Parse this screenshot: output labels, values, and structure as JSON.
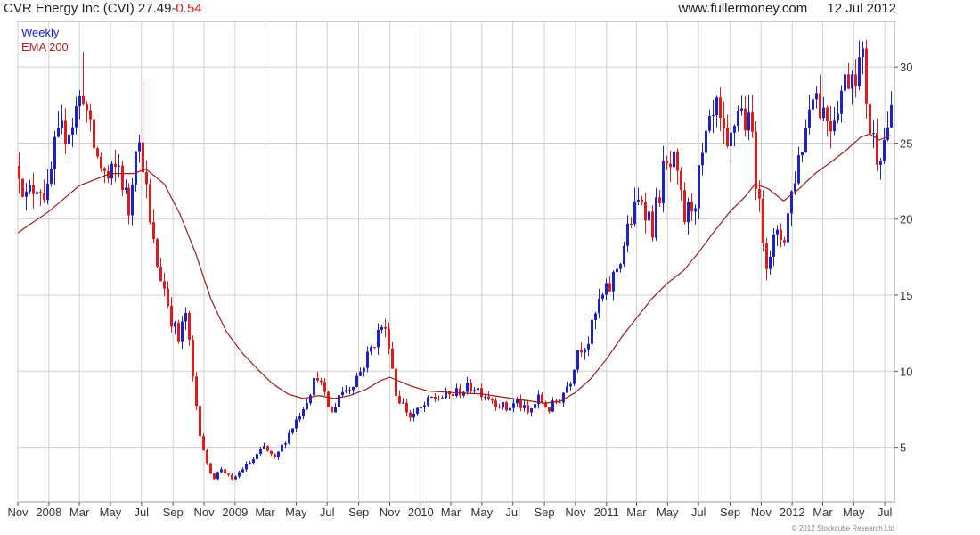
{
  "header": {
    "company": "CVR Energy Inc (CVI)",
    "price": "27.49",
    "change": "-0.54",
    "site": "www.fullermoney.com",
    "date": "12 Jul 2012"
  },
  "footer": {
    "credit": "© 2012 Stockcube Research Ltd"
  },
  "colors": {
    "up": "#1a22c8",
    "down": "#e01b1b",
    "ema": "#9b1c1c",
    "grid": "#cfcfcf",
    "axis": "#555555"
  },
  "chart_data": {
    "type": "candlestick",
    "frequency_label": "Weekly",
    "indicator_label": "EMA 200",
    "x_range": [
      "2007-11-01",
      "2012-07-20"
    ],
    "y_range": [
      1.4,
      33
    ],
    "y_ticks": [
      5,
      10,
      15,
      20,
      25,
      30
    ],
    "x_ticks": [
      {
        "date": "2007-11-01",
        "label": "Nov"
      },
      {
        "date": "2008-01-01",
        "label": "2008"
      },
      {
        "date": "2008-03-01",
        "label": "Mar"
      },
      {
        "date": "2008-05-01",
        "label": "May"
      },
      {
        "date": "2008-07-01",
        "label": "Jul"
      },
      {
        "date": "2008-09-01",
        "label": "Sep"
      },
      {
        "date": "2008-11-01",
        "label": "Nov"
      },
      {
        "date": "2009-01-01",
        "label": "2009"
      },
      {
        "date": "2009-03-01",
        "label": "Mar"
      },
      {
        "date": "2009-05-01",
        "label": "May"
      },
      {
        "date": "2009-07-01",
        "label": "Jul"
      },
      {
        "date": "2009-09-01",
        "label": "Sep"
      },
      {
        "date": "2009-11-01",
        "label": "Nov"
      },
      {
        "date": "2010-01-01",
        "label": "2010"
      },
      {
        "date": "2010-03-01",
        "label": "Mar"
      },
      {
        "date": "2010-05-01",
        "label": "May"
      },
      {
        "date": "2010-07-01",
        "label": "Jul"
      },
      {
        "date": "2010-09-01",
        "label": "Sep"
      },
      {
        "date": "2010-11-01",
        "label": "Nov"
      },
      {
        "date": "2011-01-01",
        "label": "2011"
      },
      {
        "date": "2011-03-01",
        "label": "Mar"
      },
      {
        "date": "2011-05-01",
        "label": "May"
      },
      {
        "date": "2011-07-01",
        "label": "Jul"
      },
      {
        "date": "2011-09-01",
        "label": "Sep"
      },
      {
        "date": "2011-11-01",
        "label": "Nov"
      },
      {
        "date": "2012-01-01",
        "label": "2012"
      },
      {
        "date": "2012-03-01",
        "label": "Mar"
      },
      {
        "date": "2012-05-01",
        "label": "May"
      },
      {
        "date": "2012-07-01",
        "label": "Jul"
      }
    ],
    "close_path": [
      [
        "2007-11-02",
        23.5
      ],
      [
        "2007-11-16",
        21.3
      ],
      [
        "2007-12-07",
        22.5
      ],
      [
        "2007-12-28",
        21.5
      ],
      [
        "2008-01-11",
        24.5
      ],
      [
        "2008-01-25",
        25.5
      ],
      [
        "2008-02-15",
        26.5
      ],
      [
        "2008-03-07",
        28.5
      ],
      [
        "2008-03-21",
        25.5
      ],
      [
        "2008-04-04",
        24.0
      ],
      [
        "2008-04-25",
        22.5
      ],
      [
        "2008-05-16",
        23.5
      ],
      [
        "2008-06-06",
        20.5
      ],
      [
        "2008-06-20",
        25.5
      ],
      [
        "2008-07-04",
        24.0
      ],
      [
        "2008-07-18",
        19.5
      ],
      [
        "2008-08-01",
        17.0
      ],
      [
        "2008-08-15",
        15.5
      ],
      [
        "2008-08-29",
        13.5
      ],
      [
        "2008-09-12",
        12.0
      ],
      [
        "2008-09-26",
        13.8
      ],
      [
        "2008-10-10",
        9.5
      ],
      [
        "2008-10-24",
        6.0
      ],
      [
        "2008-11-07",
        3.8
      ],
      [
        "2008-11-21",
        3.0
      ],
      [
        "2008-12-05",
        3.6
      ],
      [
        "2008-12-26",
        2.8
      ],
      [
        "2009-01-16",
        3.6
      ],
      [
        "2009-02-06",
        4.2
      ],
      [
        "2009-02-27",
        5.0
      ],
      [
        "2009-03-20",
        4.2
      ],
      [
        "2009-04-10",
        5.5
      ],
      [
        "2009-05-01",
        6.8
      ],
      [
        "2009-05-22",
        8.2
      ],
      [
        "2009-06-12",
        9.8
      ],
      [
        "2009-06-26",
        8.3
      ],
      [
        "2009-07-10",
        7.2
      ],
      [
        "2009-07-24",
        8.5
      ],
      [
        "2009-08-14",
        9.0
      ],
      [
        "2009-09-04",
        10.0
      ],
      [
        "2009-09-25",
        11.5
      ],
      [
        "2009-10-16",
        13.0
      ],
      [
        "2009-10-30",
        12.0
      ],
      [
        "2009-11-13",
        8.5
      ],
      [
        "2009-11-27",
        7.8
      ],
      [
        "2009-12-11",
        7.0
      ],
      [
        "2010-01-01",
        7.5
      ],
      [
        "2010-01-22",
        8.2
      ],
      [
        "2010-02-12",
        8.3
      ],
      [
        "2010-03-05",
        8.5
      ],
      [
        "2010-03-26",
        8.8
      ],
      [
        "2010-04-16",
        9.0
      ],
      [
        "2010-05-07",
        8.5
      ],
      [
        "2010-05-28",
        8.0
      ],
      [
        "2010-06-18",
        7.5
      ],
      [
        "2010-07-09",
        8.0
      ],
      [
        "2010-07-30",
        7.2
      ],
      [
        "2010-08-20",
        8.2
      ],
      [
        "2010-09-10",
        7.5
      ],
      [
        "2010-10-01",
        8.2
      ],
      [
        "2010-10-22",
        9.5
      ],
      [
        "2010-11-05",
        11.5
      ],
      [
        "2010-11-26",
        12.0
      ],
      [
        "2010-12-17",
        14.5
      ],
      [
        "2011-01-07",
        15.5
      ],
      [
        "2011-01-28",
        17.5
      ],
      [
        "2011-02-18",
        20.0
      ],
      [
        "2011-03-11",
        21.5
      ],
      [
        "2011-04-01",
        19.5
      ],
      [
        "2011-04-22",
        23.0
      ],
      [
        "2011-05-13",
        23.5
      ],
      [
        "2011-06-03",
        20.0
      ],
      [
        "2011-06-24",
        21.5
      ],
      [
        "2011-07-15",
        25.0
      ],
      [
        "2011-08-05",
        27.0
      ],
      [
        "2011-08-26",
        24.0
      ],
      [
        "2011-09-16",
        27.5
      ],
      [
        "2011-09-30",
        26.5
      ],
      [
        "2011-10-14",
        25.5
      ],
      [
        "2011-10-28",
        20.5
      ],
      [
        "2011-11-11",
        17.5
      ],
      [
        "2011-11-25",
        18.5
      ],
      [
        "2011-12-16",
        19.0
      ],
      [
        "2012-01-06",
        23.0
      ],
      [
        "2012-01-27",
        26.0
      ],
      [
        "2012-02-10",
        29.0
      ],
      [
        "2012-02-24",
        27.5
      ],
      [
        "2012-03-16",
        26.5
      ],
      [
        "2012-04-06",
        28.5
      ],
      [
        "2012-04-27",
        30.0
      ],
      [
        "2012-05-18",
        30.2
      ],
      [
        "2012-06-01",
        26.0
      ],
      [
        "2012-06-15",
        24.5
      ],
      [
        "2012-06-29",
        25.2
      ],
      [
        "2012-07-13",
        27.5
      ]
    ],
    "ema_path": [
      [
        "2007-11-01",
        19.1
      ],
      [
        "2008-01-01",
        20.5
      ],
      [
        "2008-03-01",
        22.2
      ],
      [
        "2008-05-01",
        23.0
      ],
      [
        "2008-06-15",
        23.0
      ],
      [
        "2008-07-10",
        23.3
      ],
      [
        "2008-08-15",
        22.3
      ],
      [
        "2008-09-15",
        20.3
      ],
      [
        "2008-10-15",
        17.8
      ],
      [
        "2008-11-15",
        14.7
      ],
      [
        "2008-12-15",
        12.6
      ],
      [
        "2009-01-15",
        11.2
      ],
      [
        "2009-02-15",
        10.1
      ],
      [
        "2009-03-15",
        9.2
      ],
      [
        "2009-04-15",
        8.5
      ],
      [
        "2009-05-15",
        8.2
      ],
      [
        "2009-06-15",
        8.4
      ],
      [
        "2009-07-15",
        8.2
      ],
      [
        "2009-08-15",
        8.4
      ],
      [
        "2009-09-15",
        8.8
      ],
      [
        "2009-10-15",
        9.4
      ],
      [
        "2009-11-01",
        9.6
      ],
      [
        "2009-12-15",
        9.0
      ],
      [
        "2010-01-15",
        8.7
      ],
      [
        "2010-03-01",
        8.6
      ],
      [
        "2010-05-01",
        8.5
      ],
      [
        "2010-07-01",
        8.2
      ],
      [
        "2010-09-01",
        7.9
      ],
      [
        "2010-10-01",
        8.0
      ],
      [
        "2010-11-01",
        8.6
      ],
      [
        "2010-12-01",
        9.5
      ],
      [
        "2011-01-01",
        10.8
      ],
      [
        "2011-02-01",
        12.3
      ],
      [
        "2011-03-01",
        13.5
      ],
      [
        "2011-04-01",
        14.8
      ],
      [
        "2011-05-01",
        15.8
      ],
      [
        "2011-06-01",
        16.6
      ],
      [
        "2011-07-01",
        17.8
      ],
      [
        "2011-08-01",
        19.2
      ],
      [
        "2011-09-01",
        20.5
      ],
      [
        "2011-10-01",
        21.5
      ],
      [
        "2011-10-20",
        22.3
      ],
      [
        "2011-11-15",
        22.0
      ],
      [
        "2011-12-15",
        21.2
      ],
      [
        "2012-01-15",
        22.0
      ],
      [
        "2012-02-15",
        23.0
      ],
      [
        "2012-03-15",
        23.7
      ],
      [
        "2012-04-15",
        24.5
      ],
      [
        "2012-05-15",
        25.4
      ],
      [
        "2012-06-01",
        25.6
      ],
      [
        "2012-06-20",
        25.2
      ],
      [
        "2012-07-13",
        25.5
      ]
    ],
    "spikes": [
      {
        "date": "2008-03-07",
        "value": 31.0
      },
      {
        "date": "2008-07-04",
        "value": 29.0
      },
      {
        "date": "2012-05-25",
        "value": 31.8
      }
    ],
    "last_close": 27.49
  }
}
